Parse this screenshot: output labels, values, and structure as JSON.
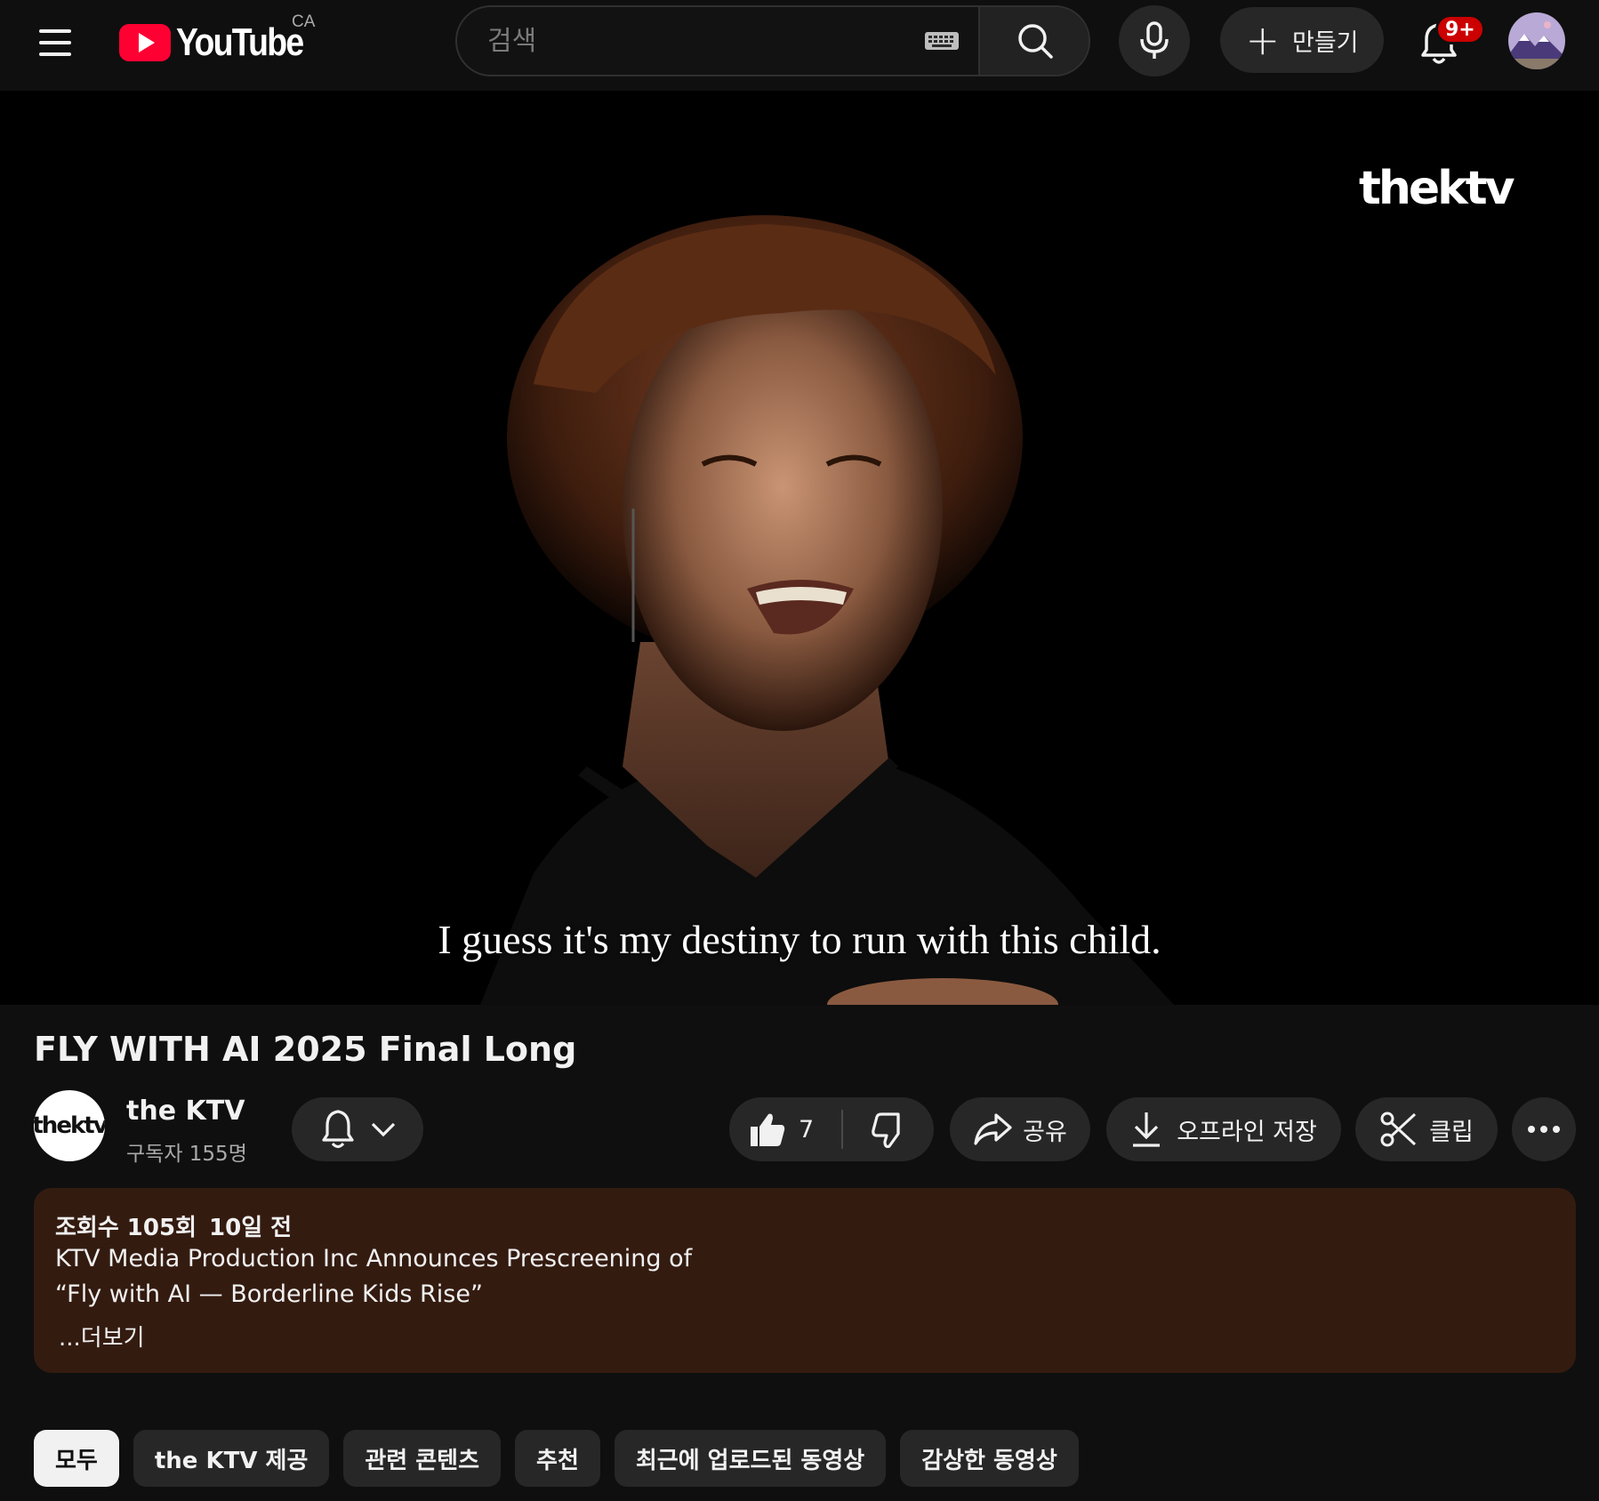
{
  "header": {
    "logo_text": "YouTube",
    "country_code": "CA",
    "search_placeholder": "검색",
    "create_label": "만들기",
    "notification_count": "9+",
    "icons": [
      "menu-icon",
      "youtube-logo-icon",
      "keyboard-icon",
      "search-icon",
      "microphone-icon",
      "plus-icon",
      "bell-icon"
    ]
  },
  "video": {
    "watermark": "thektv",
    "caption": "I guess it's my destiny to run with this child."
  },
  "meta": {
    "title": "FLY WITH AI 2025 Final Long",
    "channel_avatar_text": "thektv",
    "channel_name": "the KTV",
    "subscribers": "구독자 155명",
    "likes": "7",
    "share_label": "공유",
    "download_label": "오프라인 저장",
    "clip_label": "클립"
  },
  "description": {
    "views": "조회수 105회",
    "age": "10일 전",
    "lines": [
      "KTV Media Production Inc Announces Prescreening of",
      "“Fly with AI — Borderline Kids Rise”"
    ],
    "more": "...더보기"
  },
  "chips": [
    "모두",
    "the KTV 제공",
    "관련 콘텐츠",
    "추천",
    "최근에 업로드된 동영상",
    "감상한 동영상"
  ],
  "colors": {
    "background": "#0f0f0f",
    "youtube_red": "#ff0033",
    "badge_red": "#cc0000",
    "button_bg": "#272727",
    "description_bg": "#341b10",
    "active_chip": "#f1f1f1"
  }
}
